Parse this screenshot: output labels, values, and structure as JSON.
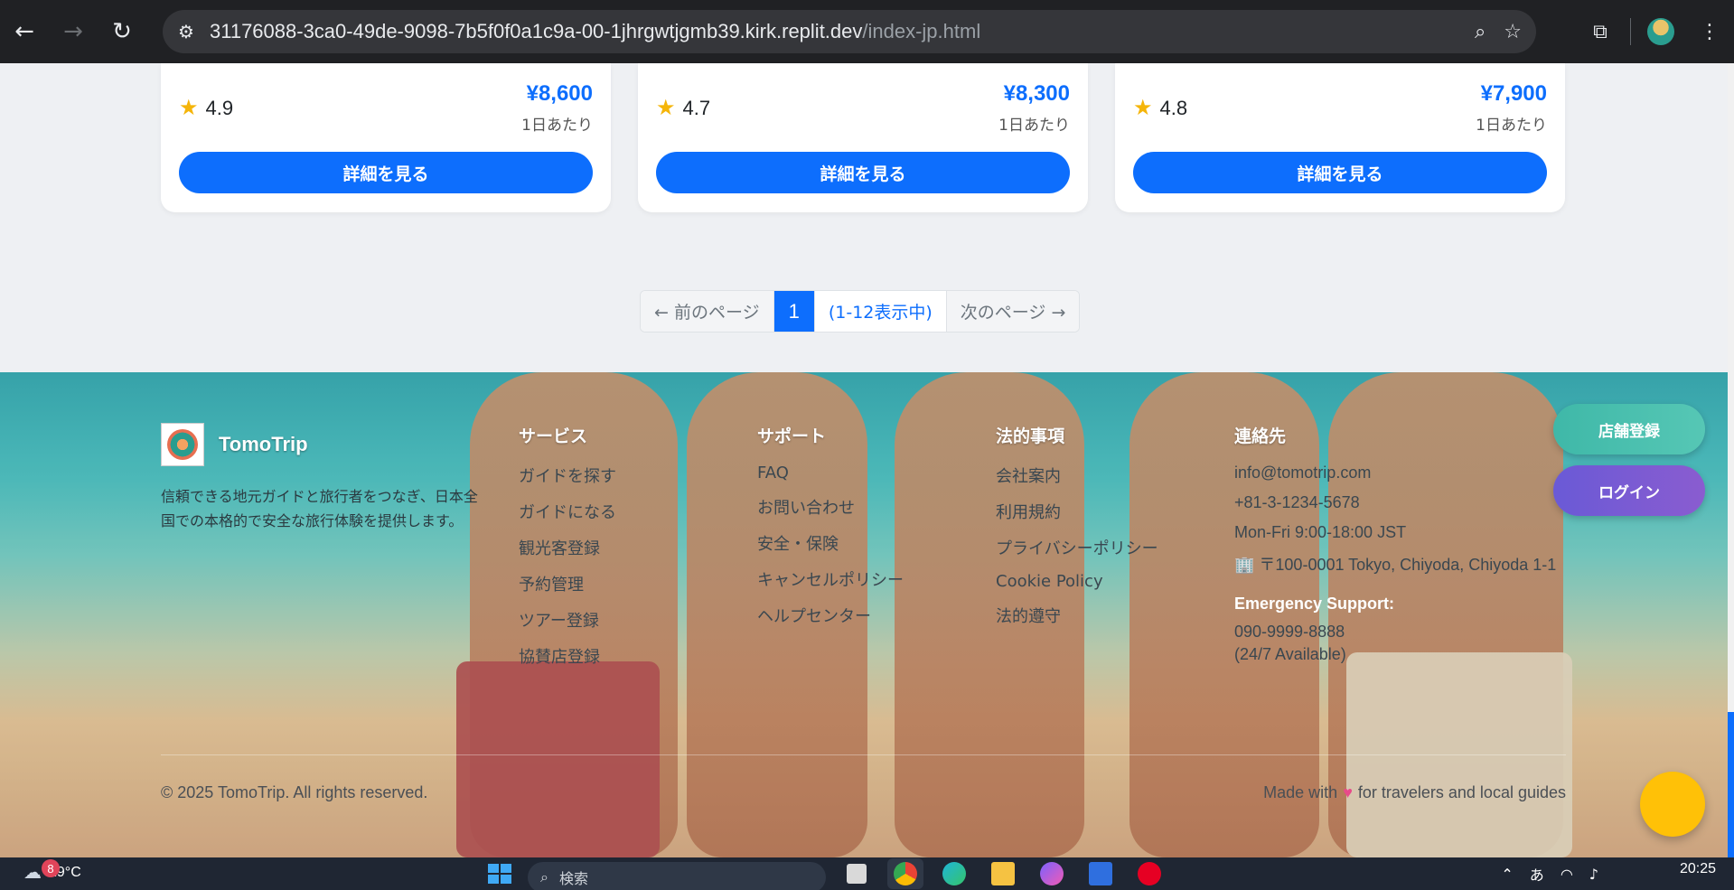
{
  "browser": {
    "url_host": "31176088-3ca0-49de-9098-7b5f0f0a1c9a-00-1jhrgwtjgmb39.kirk.replit.dev",
    "url_path": "/index-jp.html",
    "back_icon": "←",
    "forward_icon": "→",
    "reload_icon": "↻",
    "site_info_icon": "⚙",
    "zoom_icon": "⌕",
    "bookmark_icon": "☆",
    "extensions_icon": "⧉",
    "menu_icon": "⋮"
  },
  "cards": [
    {
      "rating": "4.9",
      "price": "¥8,600",
      "price_unit": "1日あたり",
      "button": "詳細を見る"
    },
    {
      "rating": "4.7",
      "price": "¥8,300",
      "price_unit": "1日あたり",
      "button": "詳細を見る"
    },
    {
      "rating": "4.8",
      "price": "¥7,900",
      "price_unit": "1日あたり",
      "button": "詳細を見る"
    }
  ],
  "star_icon": "★",
  "pagination": {
    "prev": "← 前のページ",
    "current": "1",
    "info": "(1-12表示中)",
    "next": "次のページ →"
  },
  "footer": {
    "brand": "TomoTrip",
    "description": "信頼できる地元ガイドと旅行者をつなぎ、日本全国での本格的で安全な旅行体験を提供します。",
    "services": {
      "title": "サービス",
      "links": [
        "ガイドを探す",
        "ガイドになる",
        "観光客登録",
        "予約管理",
        "ツアー登録",
        "協賛店登録"
      ]
    },
    "support": {
      "title": "サポート",
      "links": [
        "FAQ",
        "お問い合わせ",
        "安全・保険",
        "キャンセルポリシー",
        "ヘルプセンター"
      ]
    },
    "legal": {
      "title": "法的事項",
      "links": [
        "会社案内",
        "利用規約",
        "プライバシーポリシー",
        "Cookie Policy",
        "法的遵守"
      ]
    },
    "contact": {
      "title": "連絡先",
      "email": "info@tomotrip.com",
      "phone": "+81-3-1234-5678",
      "hours": "Mon-Fri 9:00-18:00 JST",
      "address": "🏢 〒100-0001 Tokyo, Chiyoda, Chiyoda 1-1",
      "emergency_title": "Emergency Support:",
      "emergency_phone": "090-9999-8888",
      "emergency_note": "(24/7 Available)"
    },
    "store_button": "店舗登録",
    "login_button": "ログイン",
    "copyright": "© 2025 TomoTrip. All rights reserved.",
    "made_with_prefix": "Made with",
    "heart_icon": "♥",
    "made_with_suffix": "for travelers and local guides"
  },
  "taskbar": {
    "notification_count": "8",
    "temperature": "29°C",
    "search_placeholder": "検索",
    "ime": "あ",
    "time": "20:25"
  },
  "colors": {
    "accent": "#0d6efd",
    "store_button": "#3fb8a8",
    "login_button": "#6a5ad6",
    "chat_fab": "#ffc107"
  }
}
